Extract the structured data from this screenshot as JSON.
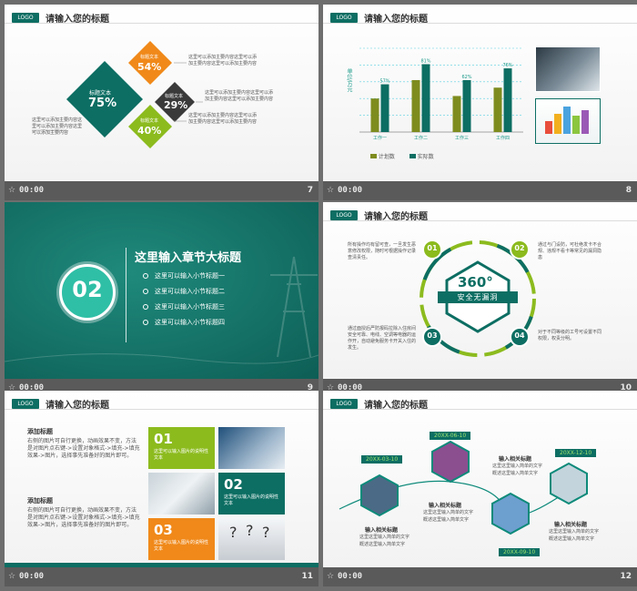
{
  "common": {
    "logo": "LOGO",
    "title": "请输入您的标题",
    "time": "00:00"
  },
  "slide7": {
    "number": "7",
    "main_label": "标题文本",
    "main_pct": "75%",
    "orange_label": "标题文本",
    "orange_pct": "54%",
    "dark_label": "标题文本",
    "dark_pct": "29%",
    "green_label": "标题文本",
    "green_pct": "40%",
    "text_top": "这里可以添加主要内容这里可以添加主要内容这里可以添加主要内容",
    "text_mid": "这里可以添加主要内容这里可以添加主要内容这里可以添加主要内容",
    "text_low": "这里可以添加主要内容这里可以添加主要内容这里可以添加主要内容",
    "text_left": "这里可以添加主要内容这里可以添加主要内容这里可以添加主要内容"
  },
  "slide8": {
    "number": "8",
    "ylabel": "单位/万元",
    "legend_plan": "计划数",
    "legend_actual": "实际数",
    "plan_color": "#7e8c1e",
    "actual_color": "#0d6e63"
  },
  "chart_data": {
    "type": "bar",
    "categories": [
      "工作一",
      "工作二",
      "工作三",
      "工作四"
    ],
    "series": [
      {
        "name": "计划数",
        "values": [
          40,
          62,
          43,
          53
        ]
      },
      {
        "name": "实际数",
        "values": [
          57,
          81,
          62,
          76
        ]
      }
    ],
    "data_labels": [
      "57%",
      "81%",
      "62%",
      "76%"
    ],
    "ylim": [
      0,
      100
    ],
    "ylabel": "单位/万元"
  },
  "slide9": {
    "number": "9",
    "badge": "02",
    "heading": "这里输入章节大标题",
    "items": [
      "这里可以输入小节标题一",
      "这里可以输入小节标题二",
      "这里可以输入小节标题三",
      "这里可以输入小节标题四"
    ]
  },
  "slide10": {
    "number": "10",
    "center_big": "360°",
    "center_sub": "安全无漏洞",
    "n1": "01",
    "n2": "02",
    "n3": "03",
    "n4": "04",
    "t1": "所有操作均有留可查，一旦发生恶意修改权限，随时可根据操作记录查清责任。",
    "t2": "通过与门设防，可杜绝发卡不合规、违规不看卡等常见的漏洞隐患",
    "t3": "通过面授后严防报码拉除入住房间安全可靠、电线、空调等电器的运作开，自动避免服务卡开关入住的发生。",
    "t4": "对于不同等级的工号可设置不同权限，权责分明。"
  },
  "slide11": {
    "number": "11",
    "h1": "添加标题",
    "p1": "右侧的图片可自行更换，动画效果不变，方法是对图片点右键->设置对象格式->填充->填充效果->图片，选择事先准备好的图片即可。",
    "h2": "添加标题",
    "p2": "右侧的图片可自行更换，动画效果不变，方法是对图片点右键->设置对象格式->填充->填充效果->图片，选择事先准备好的图片即可。",
    "b1_num": "01",
    "b1_text": "这里可以输入图片的说明性文本",
    "b2_num": "02",
    "b2_text": "这里可以输入图片的说明性文本",
    "b3_num": "03",
    "b3_text": "这里可以输入图片的说明性文本"
  },
  "slide12": {
    "number": "12",
    "dates": [
      "20XX-03-10",
      "20XX-06-10",
      "20XX-09-10",
      "20XX-12-10"
    ],
    "item_title": "输入相关标题",
    "item_text1": "这里这里输入简单的文字",
    "item_text2": "概述这里输入简单文字"
  }
}
